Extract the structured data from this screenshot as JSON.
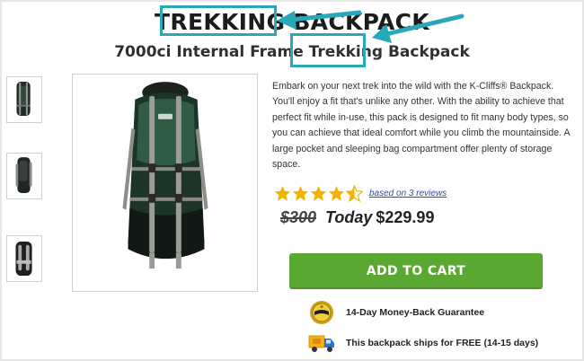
{
  "header": {
    "title": "TREKKING BACKPACK",
    "subtitle": "7000ci Internal Frame Trekking Backpack"
  },
  "gallery": {
    "thumbnails": [
      {
        "name": "backpack-front-view"
      },
      {
        "name": "backpack-side-view"
      },
      {
        "name": "backpack-back-view"
      }
    ]
  },
  "description": "Embark on your next trek into the wild with the K-Cliffs® Backpack. You'll enjoy a fit that's unlike any other. With the ability to achieve that perfect fit while in-use, this pack is designed to fit many body types, so you can achieve that ideal comfort while you climb the mountainside. A large pocket and sleeping bag compartment offer plenty of storage space.",
  "rating": {
    "value": 4.5,
    "max": 5,
    "reviews_label": "based on 3 reviews"
  },
  "pricing": {
    "old_price": "$300",
    "today_label": "Today",
    "new_price": "$229.99"
  },
  "cta": {
    "add_to_cart_label": "ADD TO CART"
  },
  "guarantees": [
    {
      "icon": "money-back-badge-icon",
      "text": "14-Day Money-Back Guarantee"
    },
    {
      "icon": "delivery-truck-icon",
      "text": "This backpack ships for FREE (14-15 days)"
    }
  ],
  "colors": {
    "highlight_box": "#28a9b8",
    "button_green": "#5aa832",
    "star_gold": "#f0b400",
    "link_blue": "#2c4ea6"
  }
}
